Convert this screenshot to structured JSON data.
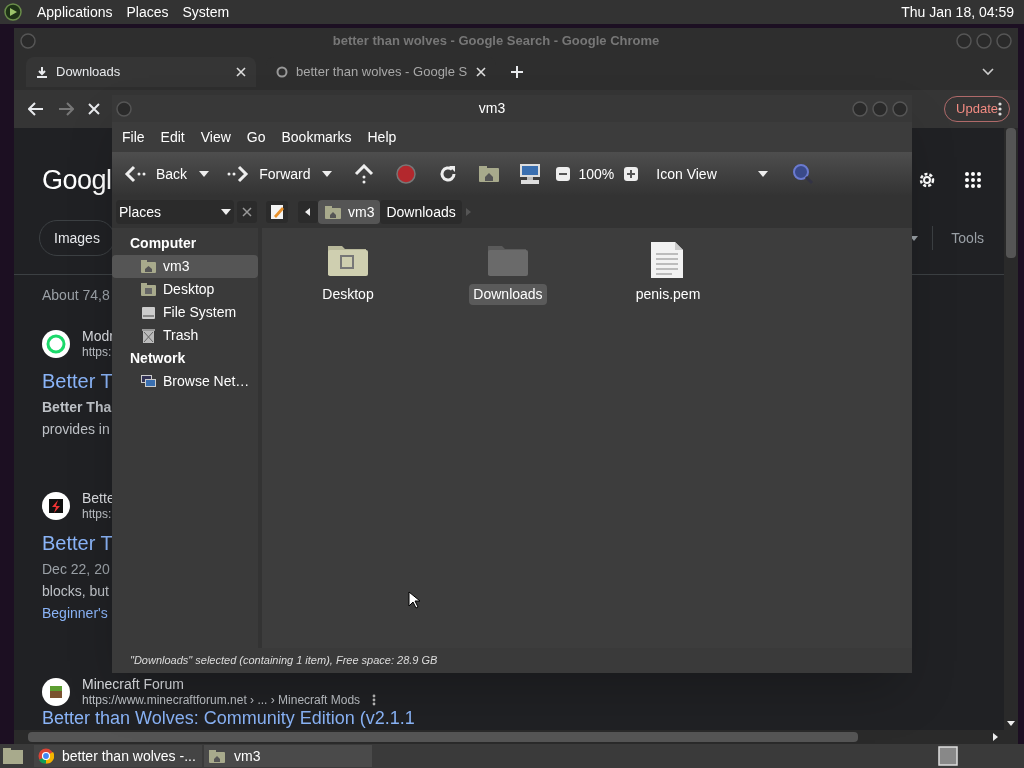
{
  "top_panel": {
    "menus": [
      "Applications",
      "Places",
      "System"
    ],
    "clock": "Thu Jan 18, 04:59"
  },
  "browser": {
    "title": "better than wolves - Google Search - Google Chrome",
    "tabs": [
      {
        "label": "Downloads",
        "kind": "download",
        "selected": true
      },
      {
        "label": "better than wolves - Google S",
        "kind": "globe",
        "selected": false
      }
    ],
    "update_button": "Update",
    "page": {
      "logo": "Googl",
      "chips": [
        "Images"
      ],
      "tools": "Tools",
      "stats": "About 74,8",
      "results": [
        {
          "kind": "sync",
          "site": "Modr",
          "url": "https:",
          "title": "Better T",
          "lines": [
            {
              "text": "Better Tha",
              "kind": "bold"
            },
            {
              "text": "provides in",
              "kind": "text"
            }
          ]
        },
        {
          "kind": "bolt",
          "site": "Bette",
          "url": "https:",
          "title": "Better T",
          "lines": [
            {
              "text": "Dec 22, 20",
              "kind": "date"
            },
            {
              "text": "blocks, but",
              "kind": "text"
            },
            {
              "text": "Beginner's",
              "kind": "link"
            }
          ]
        },
        {
          "kind": "block",
          "site": "Minecraft Forum",
          "url": "https://www.minecraftforum.net › ... › Minecraft Mods",
          "title": "Better than Wolves: Community Edition (v2.1.1"
        }
      ]
    }
  },
  "file_manager": {
    "title": "vm3",
    "menus": [
      "File",
      "Edit",
      "View",
      "Go",
      "Bookmarks",
      "Help"
    ],
    "toolbar": {
      "back": "Back",
      "forward": "Forward",
      "zoom": "100%",
      "view": "Icon View"
    },
    "pane_selector": "Places",
    "path": [
      {
        "label": "vm3",
        "kind": "home",
        "selected": true
      },
      {
        "label": "Downloads",
        "kind": "plain",
        "selected": false
      }
    ],
    "sidebar": [
      {
        "heading": "Computer",
        "items": [
          {
            "label": "vm3",
            "kind": "home",
            "selected": true
          },
          {
            "label": "Desktop",
            "kind": "desktop",
            "selected": false
          },
          {
            "label": "File System",
            "kind": "drive",
            "selected": false
          },
          {
            "label": "Trash",
            "kind": "trash",
            "selected": false
          }
        ]
      },
      {
        "heading": "Network",
        "items": [
          {
            "label": "Browse Net…",
            "kind": "network",
            "selected": false
          }
        ]
      }
    ],
    "files": [
      {
        "name": "Desktop",
        "kind": "desktop-folder",
        "selected": false
      },
      {
        "name": "Downloads",
        "kind": "folder",
        "selected": true
      },
      {
        "name": "penis.pem",
        "kind": "document",
        "selected": false
      }
    ],
    "status": "\"Downloads\" selected (containing 1 item), Free space: 28.9 GB"
  },
  "taskbar": {
    "items": [
      {
        "label": "better than wolves -...",
        "kind": "browser"
      },
      {
        "label": "vm3",
        "kind": "home"
      }
    ]
  }
}
